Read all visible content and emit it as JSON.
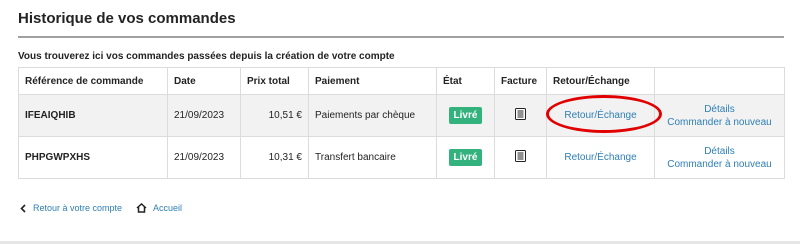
{
  "page": {
    "title": "Historique de vos commandes",
    "intro": "Vous trouverez ici vos commandes passées depuis la création de votre compte"
  },
  "table": {
    "headers": {
      "reference": "Référence de commande",
      "date": "Date",
      "total": "Prix total",
      "payment": "Paiement",
      "state": "État",
      "invoice": "Facture",
      "return": "Retour/Échange",
      "actions": ""
    },
    "rows": [
      {
        "reference": "IFEAIQHIB",
        "date": "21/09/2023",
        "total": "10,51 €",
        "payment": "Paiements par chèque",
        "state": "Livré",
        "invoice_icon": "invoice-document-icon",
        "return_link": "Retour/Échange",
        "details_link": "Détails",
        "reorder_link": "Commander à nouveau"
      },
      {
        "reference": "PHPGWPXHS",
        "date": "21/09/2023",
        "total": "10,31 €",
        "payment": "Transfert bancaire",
        "state": "Livré",
        "invoice_icon": "invoice-document-icon",
        "return_link": "Retour/Échange",
        "details_link": "Détails",
        "reorder_link": "Commander à nouveau"
      }
    ]
  },
  "footer": {
    "back_link": "Retour à votre compte",
    "home_link": "Accueil"
  },
  "colors": {
    "badge_delivered": "#34b27d",
    "link": "#2f7fb5",
    "highlight": "#e10000",
    "row_shaded": "#f2f2f2"
  }
}
